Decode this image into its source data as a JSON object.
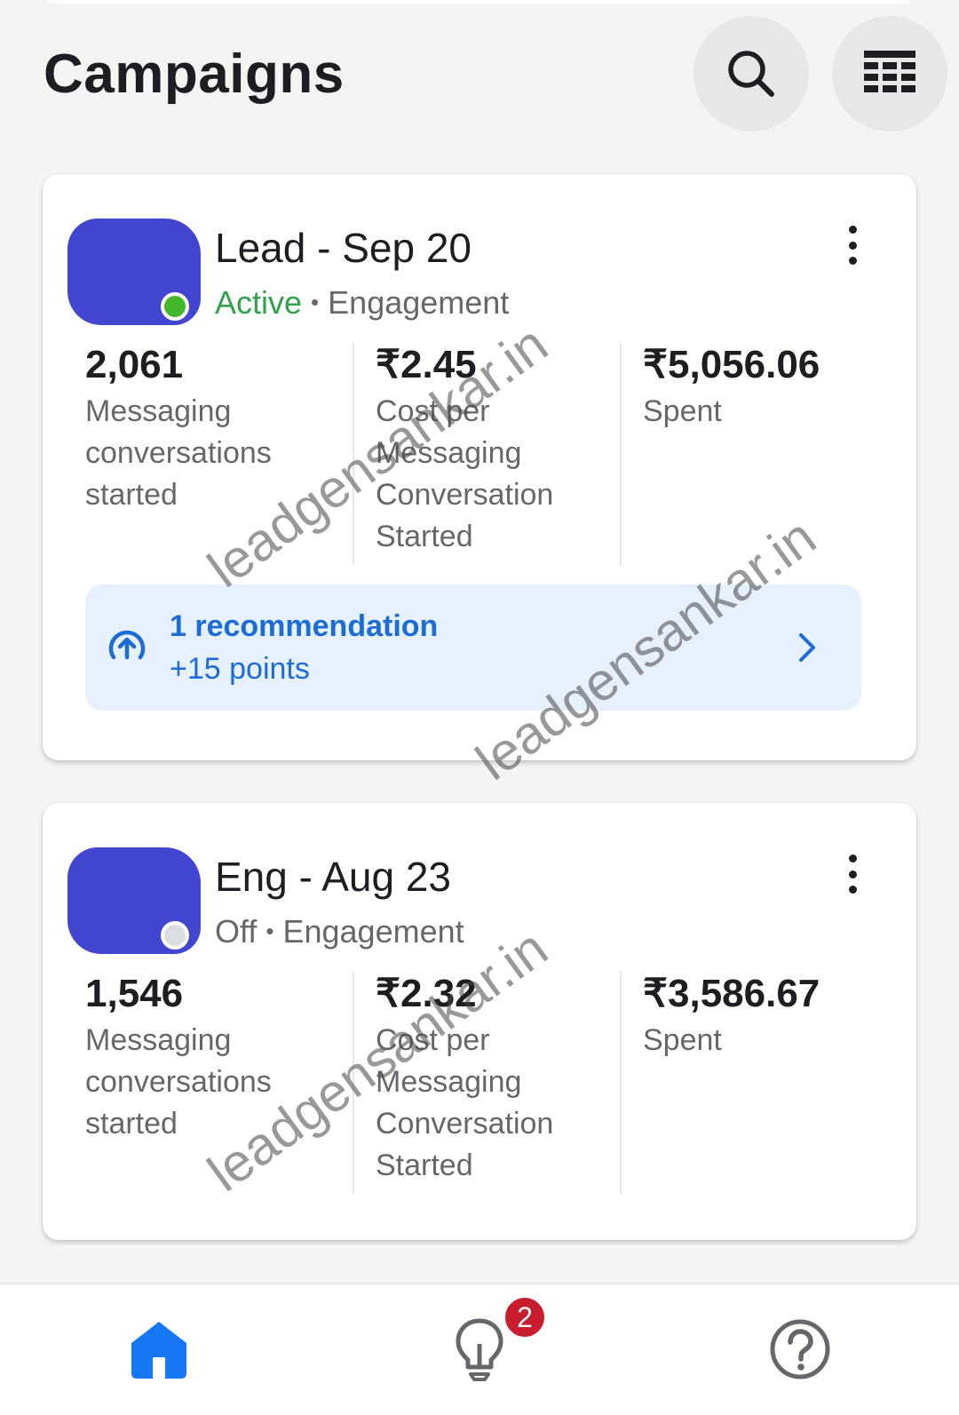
{
  "header": {
    "title": "Campaigns",
    "search_icon": "search-icon",
    "table_icon": "table-view-icon"
  },
  "campaigns": [
    {
      "name": "Lead - Sep 20",
      "status": "Active",
      "status_color": "#31a24c",
      "separator": "•",
      "objective": "Engagement",
      "metrics": [
        {
          "value": "2,061",
          "label": "Messaging conversations started"
        },
        {
          "value": "₹2.45",
          "label": "Cost per Messaging Conversation Started"
        },
        {
          "value": "₹5,056.06",
          "label": "Spent"
        }
      ],
      "recommendation": {
        "title": "1 recommendation",
        "points": "+15 points"
      }
    },
    {
      "name": "Eng - Aug 23",
      "status": "Off",
      "status_color": "#dadde1",
      "separator": "•",
      "objective": "Engagement",
      "metrics": [
        {
          "value": "1,546",
          "label": "Messaging conversations started"
        },
        {
          "value": "₹2.32",
          "label": "Cost per Messaging Conversation Started"
        },
        {
          "value": "₹3,586.67",
          "label": "Spent"
        }
      ]
    }
  ],
  "watermark": "leadgensankar.in",
  "bottom_nav": {
    "items": [
      {
        "icon": "home-icon",
        "active": true
      },
      {
        "icon": "lightbulb-icon",
        "active": false,
        "badge": "2"
      },
      {
        "icon": "help-icon",
        "active": false
      }
    ],
    "accent": "#1877f2"
  }
}
